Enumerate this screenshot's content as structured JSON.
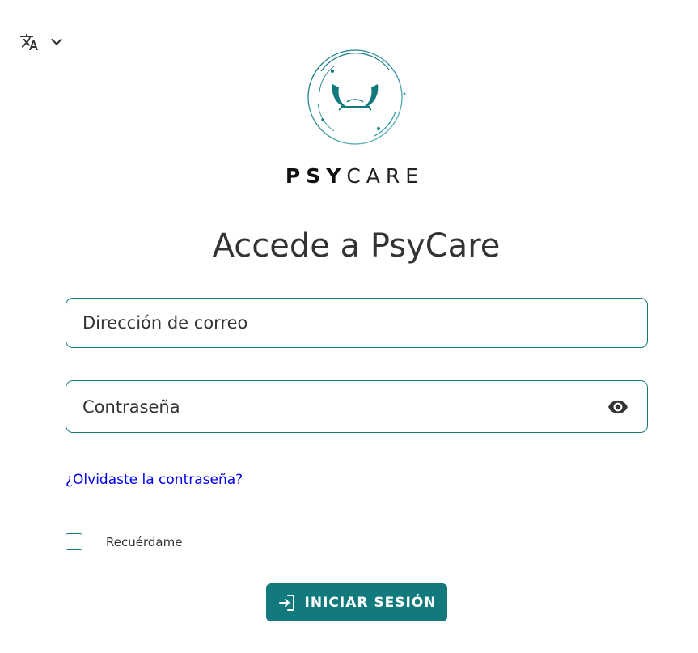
{
  "language_selector": {
    "icon": "translate-icon",
    "chevron": "chevron-down-icon"
  },
  "brand": {
    "name_bold": "PSY",
    "name_light": "CARE",
    "logo_icon": "psycare-logo",
    "color": "#127a7d"
  },
  "title": "Accede a PsyCare",
  "form": {
    "email_placeholder": "Dirección de correo",
    "email_value": "",
    "password_placeholder": "Contraseña",
    "password_value": "",
    "password_toggle_icon": "eye-icon",
    "forgot_password": "¿Olvidaste la contraseña?",
    "remember_me": "Recuérdame",
    "remember_checked": false,
    "submit_label": "INICIAR SESIÓN",
    "submit_icon": "login-icon"
  },
  "colors": {
    "accent": "#127a7d",
    "link": "#0000ee",
    "text": "#333333"
  }
}
